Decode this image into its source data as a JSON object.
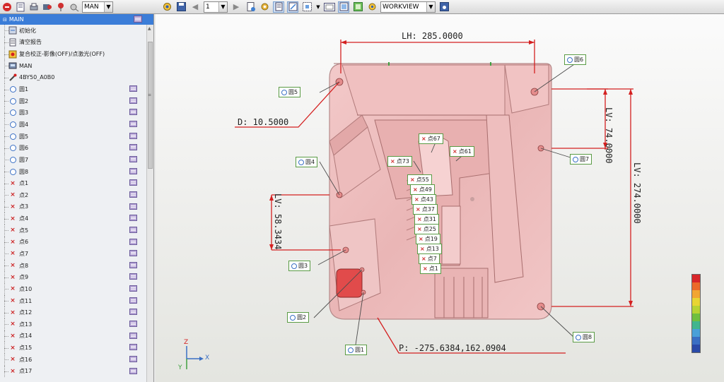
{
  "toolbar_left": {
    "view_select": "MAN"
  },
  "tree": {
    "header": "MAIN",
    "items": [
      {
        "label": "初始化",
        "icon": "initialize-icon",
        "side": false
      },
      {
        "label": "清空报告",
        "icon": "clear-report-icon",
        "side": false
      },
      {
        "label": "复合校正-影像(OFF)/点激光(OFF)",
        "icon": "composite-calibration-icon",
        "side": false
      },
      {
        "label": "MAN",
        "icon": "manual-icon",
        "side": false
      },
      {
        "label": "4BY50_A0B0",
        "icon": "probe-icon",
        "side": false
      },
      {
        "label": "圆1",
        "icon": "circle-icon",
        "side": true
      },
      {
        "label": "圆2",
        "icon": "circle-icon",
        "side": true
      },
      {
        "label": "圆3",
        "icon": "circle-icon",
        "side": true
      },
      {
        "label": "圆4",
        "icon": "circle-icon",
        "side": true
      },
      {
        "label": "圆5",
        "icon": "circle-icon",
        "side": true
      },
      {
        "label": "圆6",
        "icon": "circle-icon",
        "side": true
      },
      {
        "label": "圆7",
        "icon": "circle-icon",
        "side": true
      },
      {
        "label": "圆8",
        "icon": "circle-icon",
        "side": true
      },
      {
        "label": "点1",
        "icon": "point-icon",
        "side": true
      },
      {
        "label": "点2",
        "icon": "point-icon",
        "side": true
      },
      {
        "label": "点3",
        "icon": "point-icon",
        "side": true
      },
      {
        "label": "点4",
        "icon": "point-icon",
        "side": true
      },
      {
        "label": "点5",
        "icon": "point-icon",
        "side": true
      },
      {
        "label": "点6",
        "icon": "point-icon",
        "side": true
      },
      {
        "label": "点7",
        "icon": "point-icon",
        "side": true
      },
      {
        "label": "点8",
        "icon": "point-icon",
        "side": true
      },
      {
        "label": "点9",
        "icon": "point-icon",
        "side": true
      },
      {
        "label": "点10",
        "icon": "point-icon",
        "side": true
      },
      {
        "label": "点11",
        "icon": "point-icon",
        "side": true
      },
      {
        "label": "点12",
        "icon": "point-icon",
        "side": true
      },
      {
        "label": "点13",
        "icon": "point-icon",
        "side": true
      },
      {
        "label": "点14",
        "icon": "point-icon",
        "side": true
      },
      {
        "label": "点15",
        "icon": "point-icon",
        "side": true
      },
      {
        "label": "点16",
        "icon": "point-icon",
        "side": true
      },
      {
        "label": "点17",
        "icon": "point-icon",
        "side": true
      }
    ]
  },
  "toolbar_main": {
    "page_select": "1",
    "workview_select": "WORKVIEW"
  },
  "viewport": {
    "dimensions": {
      "lh": "LH: 285.0000",
      "d": "D: 10.5000",
      "lv1": "LV: 74.0000",
      "lv2": "LV: 274.0000",
      "lv3": "LV: 58.3434",
      "p": "P: -275.6384,162.0904"
    },
    "callouts": {
      "c1": "圆1",
      "c2": "圆2",
      "c3": "圆3",
      "c4": "圆4",
      "c5": "圆5",
      "c6": "圆6",
      "c7": "圆7",
      "c8": "圆8",
      "p67": "点67",
      "p61": "点61",
      "p73": "点73",
      "p55": "点55",
      "p49": "点49",
      "p43": "点43",
      "p37": "点37",
      "p31": "点31",
      "p25": "点25",
      "p19": "点19",
      "p13": "点13",
      "p7": "点7",
      "p1": "点1"
    },
    "axes": {
      "x": "X",
      "y": "Y",
      "z": "Z"
    },
    "color_scale": [
      "#d8262a",
      "#ec6a2a",
      "#f2a531",
      "#e8d533",
      "#b7d333",
      "#6fbf3f",
      "#42b58e",
      "#4aa0d8",
      "#3a6fc4",
      "#2a4aa8"
    ]
  }
}
